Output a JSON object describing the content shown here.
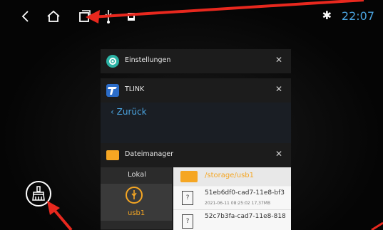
{
  "status": {
    "time": "22:07",
    "bluetooth_icon": "bluetooth-icon",
    "nav_icons": [
      "back-icon",
      "home-icon",
      "recents-icon",
      "usb-icon",
      "sd-card-icon"
    ]
  },
  "recents": [
    {
      "title": "Einstellungen",
      "icon": "settings-gear-icon"
    },
    {
      "title": "TLINK",
      "icon": "tlink-app-icon",
      "back_label": "Zurück"
    },
    {
      "title": "Dateimanager",
      "icon": "folder-icon"
    }
  ],
  "filemanager": {
    "tab_local": "Lokal",
    "tab_usb": "usb1",
    "path": "/storage/usb1",
    "files": [
      {
        "name": "51eb6df0-cad7-11e8-bf3",
        "meta": "2021-06-11 08:25:02  17,37MB"
      },
      {
        "name": "52c7b3fa-cad7-11e8-818"
      }
    ]
  },
  "clear_all_icon": "broom-clear-icon",
  "colors": {
    "accent": "#4aa3df",
    "usb_orange": "#f5a623",
    "arrow_red": "#e8281e"
  }
}
